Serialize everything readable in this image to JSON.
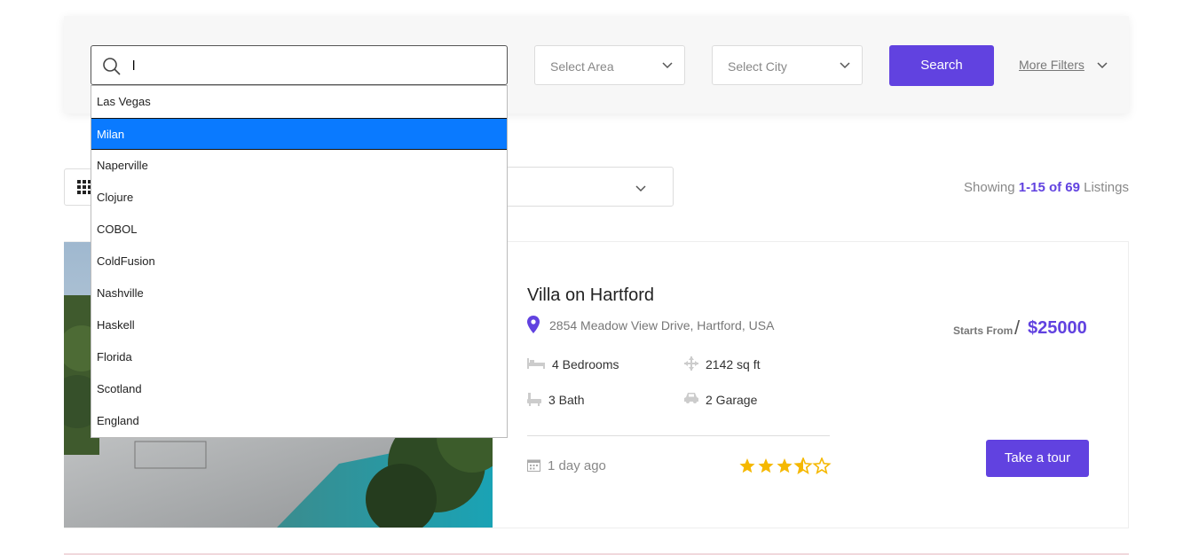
{
  "search": {
    "value": "l",
    "area_placeholder": "Select Area",
    "city_placeholder": "Select City",
    "button_label": "Search",
    "more_filters_label": "More Filters"
  },
  "dropdown": {
    "options": [
      "Las Vegas",
      "Milan",
      "Naperville",
      "Clojure",
      "COBOL",
      "ColdFusion",
      "Nashville",
      "Haskell",
      "Florida",
      "Scotland",
      "England"
    ],
    "active_index": 1
  },
  "results": {
    "prefix": "Showing ",
    "range": "1-15 of 69",
    "suffix": " Listings"
  },
  "listing": {
    "title": "Villa on Hartford",
    "address": "2854 Meadow View Drive, Hartford, USA",
    "bedrooms": "4 Bedrooms",
    "area": "2142 sq ft",
    "baths": "3 Bath",
    "garage": "2 Garage",
    "posted": "1 day ago",
    "rating": 3.5,
    "price_label": "Starts From",
    "price_sep": "/",
    "price": "$25000",
    "tour_button": "Take a tour"
  },
  "colors": {
    "accent": "#6142e0",
    "highlight": "#0a7aff",
    "star": "#f5b800"
  }
}
